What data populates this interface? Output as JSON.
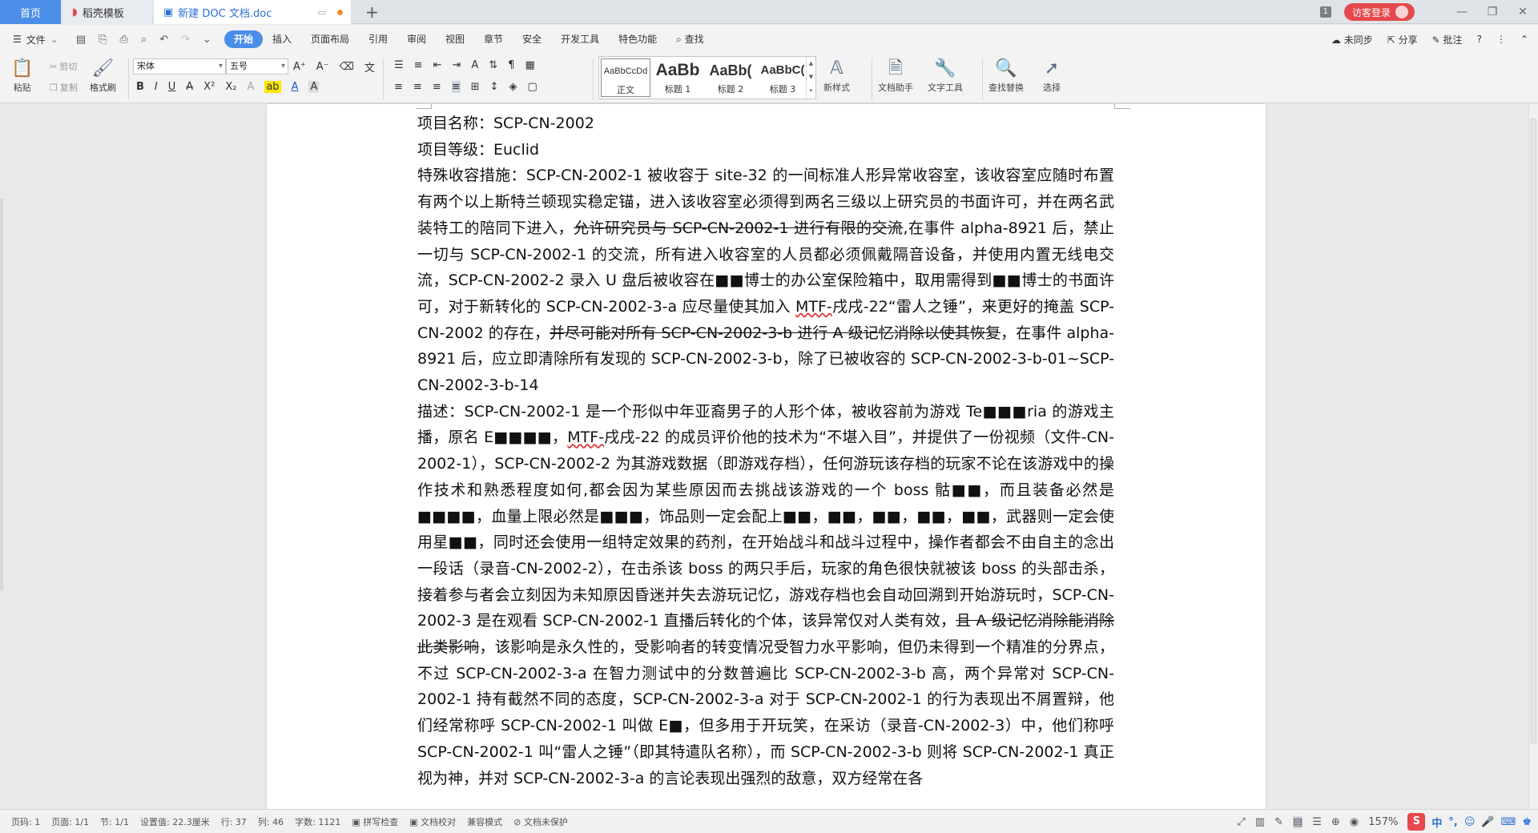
{
  "tabs": {
    "home": "首页",
    "daoke": "稻壳模板",
    "doc": "新建 DOC 文档.doc",
    "new_tab_icon": "+"
  },
  "titlebar": {
    "badge": "1",
    "login": "访客登录",
    "minimize": "—",
    "restore": "❐",
    "close": "✕"
  },
  "menu": {
    "file": "文件",
    "tabs": [
      "开始",
      "插入",
      "页面布局",
      "引用",
      "审阅",
      "视图",
      "章节",
      "安全",
      "开发工具",
      "特色功能"
    ],
    "search": "查找",
    "sync": "未同步",
    "share": "分享",
    "comment": "批注",
    "help": "?"
  },
  "ribbon": {
    "paste": "粘贴",
    "cut": "剪切",
    "copy": "复制",
    "format_painter": "格式刷",
    "font_name": "宋体",
    "font_size": "五号",
    "styles": [
      {
        "preview": "AaBbCcDd",
        "label": "正文"
      },
      {
        "preview": "AaBb",
        "label": "标题 1"
      },
      {
        "preview": "AaBb(",
        "label": "标题 2"
      },
      {
        "preview": "AaBbC(",
        "label": "标题 3"
      }
    ],
    "new_style": "新样式",
    "doc_helper": "文档助手",
    "text_tools": "文字工具",
    "find_replace": "查找替换",
    "select": "选择"
  },
  "document": {
    "paragraphs": [
      [
        {
          "t": "项目名称：SCP-CN-2002"
        }
      ],
      [
        {
          "t": "项目等级：Euclid"
        }
      ],
      [
        {
          "t": "特殊收容措施：SCP-CN-2002-1 被收容于 site-32 的一间标准人形异常收容室，该收容室应随时布置有两个以上斯特兰顿现实稳定锚，进入该收容室必须得到两名三级以上研究员的书面许可，并在两名武装特工的陪同下进入，"
        },
        {
          "t": "允许研究员与 SCP-CN-2002-1 进行有限的交流",
          "s": "strike"
        },
        {
          "t": ",在事件 alpha-8921 后，禁止一切与 SCP-CN-2002-1 的交流，所有进入收容室的人员都必须佩戴隔音设备，并使用内置无线电交流，SCP-CN-2002-2 录入 U 盘后被收容在■■博士的办公室保险箱中，取用需得到■■博士的书面许可，对于新转化的 SCP-CN-2002-3-a 应尽量使其加入 "
        },
        {
          "t": "MTF-",
          "s": "wavy"
        },
        {
          "t": "戌戌-22“雷人之锤”，来更好的掩盖 SCP-CN-2002 的存在，"
        },
        {
          "t": "并尽可能对所有 SCP-CN-2002-3-b 进行 A 级记忆消除以使其恢复",
          "s": "strike"
        },
        {
          "t": "，在事件 alpha-8921 后，应立即清除所有发现的 SCP-CN-2002-3-b，除了已被收容的 SCP-CN-2002-3-b-01~SCP-CN-2002-3-b-14"
        }
      ],
      [
        {
          "t": "描述：SCP-CN-2002-1 是一个形似中年亚裔男子的人形个体，被收容前为游戏 Te■■■ria 的游戏主播，原名 E■■■■，"
        },
        {
          "t": "MTF-",
          "s": "wavy"
        },
        {
          "t": "戌戌-22 的成员评价他的技术为“不堪入目”，并提供了一份视频（文件-CN-2002-1），SCP-CN-2002-2 为其游戏数据（即游戏存档），任何游玩该存档的玩家不论在该游戏中的操作技术和熟悉程度如何,都会因为某些原因而去挑战该游戏的一个 boss 骷■■，而且装备必然是■■■■，血量上限必然是■■■，饰品则一定会配上■■，■■，■■，■■，■■，武器则一定会使用星■■，同时还会使用一组特定效果的药剂，在开始战斗和战斗过程中，操作者都会不由自主的念出一段话（录音-CN-2002-2），在击杀该 boss 的两只手后，玩家的角色很快就被该 boss 的头部击杀，接着参与者会立刻因为未知原因昏迷并失去游玩记忆，游戏存档也会自动回溯到开始游玩时，SCP-CN-2002-3 是在观看 SCP-CN-2002-1 直播后转化的个体，该异常仅对人类有效，"
        },
        {
          "t": "且 A 级记忆消除能消除此类影响",
          "s": "strike"
        },
        {
          "t": "，该影响是永久性的，受影响者的转变情况受智力水平影响，但仍未得到一个精准的分界点，不过 SCP-CN-2002-3-a 在智力测试中的分数普遍比 SCP-CN-2002-3-b 高，两个异常对 SCP-CN-2002-1 持有截然不同的态度，SCP-CN-2002-3-a 对于 SCP-CN-2002-1 的行为表现出不屑置辩，他们经常称呼 SCP-CN-2002-1 叫做 E■，但多用于开玩笑，在采访（录音-CN-2002-3）中，他们称呼 SCP-CN-2002-1 叫“雷人之锤”（即其特遣队名称），而 SCP-CN-2002-3-b 则将 SCP-CN-2002-1 真正视为神，并对 SCP-CN-2002-3-a 的言论表现出强烈的敌意，双方经常在各"
        }
      ]
    ]
  },
  "status": {
    "page": "页码: 1",
    "pages": "页面: 1/1",
    "section": "节: 1/1",
    "setting": "设置值: 22.3厘米",
    "row": "行: 37",
    "col": "列: 46",
    "words": "字数: 1121",
    "spell": "拼写检查",
    "proof": "文档校对",
    "compat": "兼容模式",
    "protect": "文档未保护",
    "zoom": "157%",
    "ime_lang": "中"
  },
  "colors": {
    "accent": "#4a8ee8",
    "login_red": "#e5484d",
    "page_bg": "#ffffff",
    "chrome_bg": "#f3f3f3"
  }
}
